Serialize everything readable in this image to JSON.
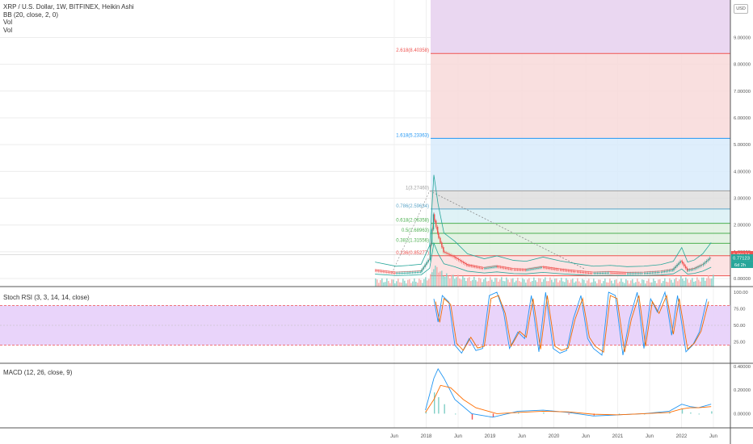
{
  "header": {
    "symbol_line": "XRP / U.S. Dollar, 1W, BITFINEX, Heikin Ashi",
    "indicators": [
      "BB (20, close, 2, 0)",
      "Vol",
      "Vol"
    ],
    "currency_button": "USD"
  },
  "colors": {
    "up": "#26a69a",
    "down": "#ef5350",
    "fib_red": "#ef5350",
    "fib_blue": "#2196f3",
    "fib_green": "#4caf50",
    "fib_gray": "#9e9e9e",
    "purple": "#9c27b0",
    "rsi_k": "#2196f3",
    "rsi_d": "#ef6c00",
    "macd": "#2196f3",
    "signal": "#ff6d00",
    "bb": "#26a69a"
  },
  "chart_data": [
    {
      "type": "line",
      "title": "XRP / U.S. Dollar, 1W, BITFINEX, Heikin Ashi",
      "x_ticks": [
        "Jun",
        "2018",
        "Jun",
        "2019",
        "Jun",
        "2020",
        "Jun",
        "2021",
        "Jun",
        "2022",
        "Jun"
      ],
      "y_ticks": [
        "9.00000",
        "8.00000",
        "7.00000",
        "6.00000",
        "5.00000",
        "4.00000",
        "3.00000",
        "2.00000",
        "1.00000",
        "0.00000"
      ],
      "ylim": [
        -0.3,
        10.4
      ],
      "series": [
        {
          "x": [
            2017.3,
            2017.55,
            2017.7,
            2017.85,
            2017.95,
            2018.0,
            2018.05,
            2018.12,
            2018.25,
            2018.4,
            2018.6,
            2018.75,
            2018.95,
            2019.1,
            2019.3,
            2019.5,
            2019.7,
            2019.9,
            2020.1,
            2020.3,
            2020.5,
            2020.7,
            2020.85,
            2020.95,
            2021.02,
            2021.1,
            2021.2,
            2021.3
          ],
          "values": [
            0.3,
            0.2,
            0.22,
            0.25,
            0.7,
            2.4,
            1.7,
            1.0,
            0.8,
            0.5,
            0.38,
            0.45,
            0.34,
            0.32,
            0.42,
            0.33,
            0.26,
            0.2,
            0.22,
            0.19,
            0.2,
            0.24,
            0.32,
            0.65,
            0.3,
            0.35,
            0.5,
            0.77
          ]
        }
      ],
      "fib_levels": [
        {
          "ratio": "2.618",
          "label": "2.618(8.40358)",
          "value": 8.40358
        },
        {
          "ratio": "1.618",
          "label": "1.618(5.23363)",
          "value": 5.23363
        },
        {
          "ratio": "1",
          "label": "1(3.27460)",
          "value": 3.2746
        },
        {
          "ratio": "0.786",
          "label": "0.786(2.59634)",
          "value": 2.59634
        },
        {
          "ratio": "0.618",
          "label": "0.618(2.06358)",
          "value": 2.06358
        },
        {
          "ratio": "0.5",
          "label": "0.5(1.68963)",
          "value": 1.68963
        },
        {
          "ratio": "0.382",
          "label": "0.382(1.31556)",
          "value": 1.31556
        },
        {
          "ratio": "0.236",
          "label": "0.236(0.85277)",
          "value": 0.85277
        },
        {
          "ratio": "0",
          "label": "",
          "value": 0.10462
        }
      ],
      "price_tags": [
        "0.89174",
        "0.77123"
      ],
      "countdown": "6d 2h"
    },
    {
      "type": "line",
      "title": "Stoch RSI (3, 3, 14, 14, close)",
      "y_ticks": [
        "100.00",
        "75.00",
        "50.00",
        "25.00"
      ],
      "ylim": [
        0,
        100
      ],
      "upper_band": 80,
      "lower_band": 20,
      "series": [
        {
          "name": "K",
          "x": [
            2018.0,
            2018.05,
            2018.1,
            2018.18,
            2018.25,
            2018.33,
            2018.42,
            2018.5,
            2018.58,
            2018.66,
            2018.75,
            2018.83,
            2018.9,
            2019.0,
            2019.08,
            2019.16,
            2019.25,
            2019.33,
            2019.42,
            2019.5,
            2019.58,
            2019.66,
            2019.75,
            2019.83,
            2019.9,
            2020.0,
            2020.08,
            2020.16,
            2020.25,
            2020.33,
            2020.42,
            2020.5,
            2020.58,
            2020.66,
            2020.75,
            2020.83,
            2020.9,
            2021.0,
            2021.08,
            2021.16,
            2021.25
          ],
          "values": [
            90,
            55,
            95,
            85,
            20,
            8,
            30,
            12,
            15,
            95,
            100,
            70,
            15,
            40,
            30,
            95,
            10,
            100,
            15,
            8,
            12,
            60,
            95,
            30,
            15,
            5,
            100,
            95,
            5,
            60,
            100,
            15,
            90,
            70,
            100,
            35,
            95,
            10,
            20,
            40,
            90
          ]
        }
      ]
    },
    {
      "type": "bar",
      "title": "MACD (12, 26, close, 9)",
      "y_ticks": [
        "0.40000",
        "0.20000",
        "0.00000"
      ],
      "ylim": [
        -0.1,
        0.4
      ],
      "series": [
        {
          "name": "MACD",
          "x": [
            2017.9,
            2018.0,
            2018.05,
            2018.12,
            2018.25,
            2018.45,
            2018.7,
            2019.0,
            2019.3,
            2019.6,
            2019.9,
            2020.2,
            2020.5,
            2020.8,
            2020.95,
            2021.05,
            2021.15,
            2021.3
          ],
          "values": [
            0.03,
            0.3,
            0.38,
            0.3,
            0.12,
            0.0,
            -0.03,
            0.02,
            0.03,
            0.01,
            -0.02,
            -0.01,
            0.0,
            0.02,
            0.08,
            0.06,
            0.05,
            0.08
          ]
        },
        {
          "name": "Signal",
          "x": [
            2017.9,
            2018.0,
            2018.08,
            2018.2,
            2018.35,
            2018.5,
            2018.75,
            2019.0,
            2019.3,
            2019.6,
            2019.9,
            2020.2,
            2020.5,
            2020.8,
            2020.95,
            2021.05,
            2021.15,
            2021.3
          ],
          "values": [
            0.01,
            0.12,
            0.24,
            0.22,
            0.12,
            0.05,
            0.0,
            0.01,
            0.02,
            0.015,
            -0.005,
            -0.01,
            0.0,
            0.01,
            0.04,
            0.05,
            0.05,
            0.06
          ]
        }
      ]
    }
  ]
}
